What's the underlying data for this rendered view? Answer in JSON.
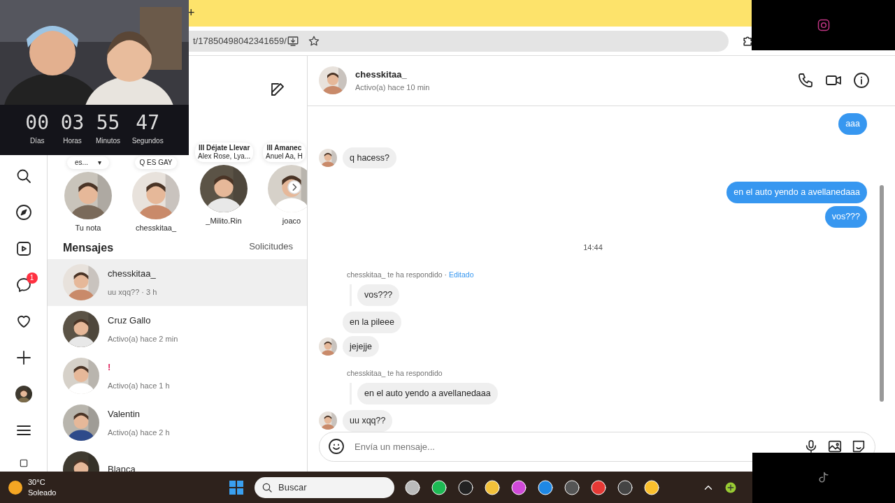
{
  "browser": {
    "new_tab": "+",
    "url": "t/17850498042341659/"
  },
  "countdown": [
    {
      "value": "00",
      "unit": "Días"
    },
    {
      "value": "03",
      "unit": "Horas"
    },
    {
      "value": "55",
      "unit": "Minutos"
    },
    {
      "value": "47",
      "unit": "Segundos"
    }
  ],
  "nav": {
    "badge": "1"
  },
  "notes": [
    {
      "kind": "text",
      "text": "es...",
      "caret": "▾",
      "story": "Tu nota"
    },
    {
      "kind": "text",
      "text": "Q ES GAY",
      "story": "chesskitaa_"
    },
    {
      "kind": "music",
      "icon": "III",
      "title": "Déjate Llevar",
      "artist": "Alex Rose, Lya...",
      "story": "_Milito.Rin"
    },
    {
      "kind": "music",
      "icon": "III",
      "title": "Amanec",
      "artist": "Anuel Aa, H",
      "story": "joaco"
    }
  ],
  "inbox": {
    "title": "Mensajes",
    "requests": "Solicitudes",
    "conversations": [
      {
        "name": "chesskitaa_",
        "status": "uu xqq?? · 3 h",
        "selected": true,
        "color": "#262626"
      },
      {
        "name": "Cruz Gallo",
        "status": "Activo(a) hace 2 min",
        "selected": false,
        "color": "#262626"
      },
      {
        "name": "!",
        "status": "Activo(a) hace 1 h",
        "selected": false,
        "color": "#e0245e"
      },
      {
        "name": "Valentin",
        "status": "Activo(a) hace 2 h",
        "selected": false,
        "color": "#262626"
      },
      {
        "name": "Blanca",
        "selected": false,
        "color": "#262626"
      }
    ]
  },
  "chat": {
    "name": "chesskitaa_",
    "status": "Activo(a) hace 10 min",
    "messages": [
      {
        "kind": "out",
        "text": "aaa"
      },
      {
        "kind": "in",
        "text": "q hacess?",
        "avatar": true
      },
      {
        "kind": "out",
        "text": "en el auto yendo a avellanedaaa"
      },
      {
        "kind": "out",
        "text": "vos???"
      },
      {
        "kind": "time",
        "text": "14:44"
      },
      {
        "kind": "reply_label",
        "text": "chesskitaa_ te ha respondido",
        "separator": "·",
        "edited": "Editado"
      },
      {
        "kind": "quote",
        "text": "vos???"
      },
      {
        "kind": "in",
        "text": "en la pileee",
        "avatar": false
      },
      {
        "kind": "in",
        "text": "jejejje",
        "avatar": true
      },
      {
        "kind": "reply_label",
        "text": "chesskitaa_ te ha respondido"
      },
      {
        "kind": "quote",
        "text": "en el auto yendo a avellanedaaa"
      },
      {
        "kind": "in",
        "text": "uu xqq??",
        "avatar": true
      }
    ],
    "composer": {
      "placeholder": "Envía un mensaje..."
    }
  },
  "taskbar": {
    "temperature": "30°C",
    "weather": "Soleado",
    "search": "Buscar"
  }
}
